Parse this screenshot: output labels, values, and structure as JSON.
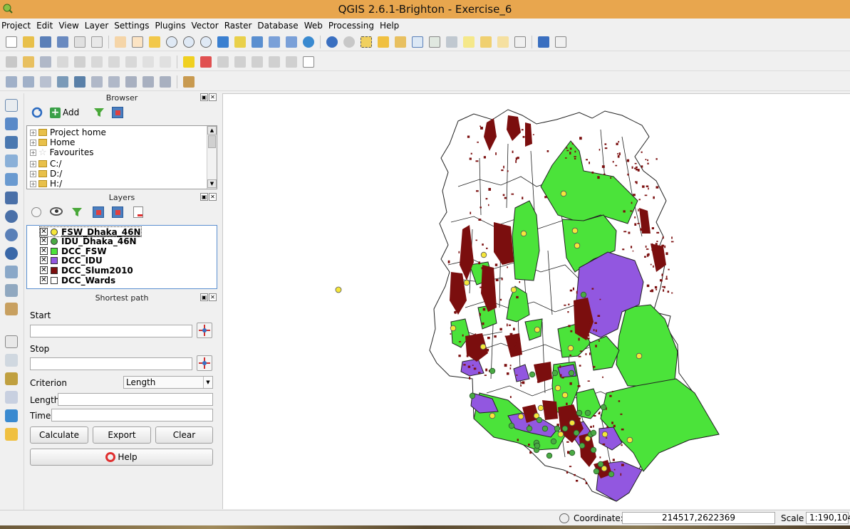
{
  "window": {
    "title": "QGIS 2.6.1-Brighton - Exercise_6"
  },
  "menu": [
    "Project",
    "Edit",
    "View",
    "Layer",
    "Settings",
    "Plugins",
    "Vector",
    "Raster",
    "Database",
    "Web",
    "Processing",
    "Help"
  ],
  "browser": {
    "title": "Browser",
    "add_label": "Add",
    "items": [
      "Project home",
      "Home",
      "Favourites",
      "C:/",
      "D:/",
      "H:/"
    ]
  },
  "layers": {
    "title": "Layers",
    "items": [
      {
        "name": "FSW_Dhaka_46N",
        "color": "#f5e63a",
        "shape": "circle"
      },
      {
        "name": "IDU_Dhaka_46N",
        "color": "#4aaa44",
        "shape": "circle"
      },
      {
        "name": "DCC_FSW",
        "color": "#4be33a",
        "shape": "square"
      },
      {
        "name": "DCC_IDU",
        "color": "#9257e0",
        "shape": "square"
      },
      {
        "name": "DCC_Slum2010",
        "color": "#7b0e0e",
        "shape": "square"
      },
      {
        "name": "DCC_Wards",
        "color": "#ffffff",
        "shape": "square"
      }
    ]
  },
  "shortest_path": {
    "title": "Shortest path",
    "start_label": "Start",
    "stop_label": "Stop",
    "criterion_label": "Criterion",
    "criterion_value": "Length",
    "length_label": "Length",
    "time_label": "Time",
    "calculate_label": "Calculate",
    "export_label": "Export",
    "clear_label": "Clear",
    "help_label": "Help"
  },
  "status": {
    "coordinate_label": "Coordinate:",
    "coordinate_value": "214517,2622369",
    "scale_label": "Scale",
    "scale_value": "1:190,104"
  },
  "colors": {
    "titlebar": "#e8a64e",
    "fsw_ward": "#4be33a",
    "idu_ward": "#9257e0",
    "slum": "#7b0e0e",
    "fsw_point": "#f5e63a",
    "idu_point": "#4aaa44"
  }
}
